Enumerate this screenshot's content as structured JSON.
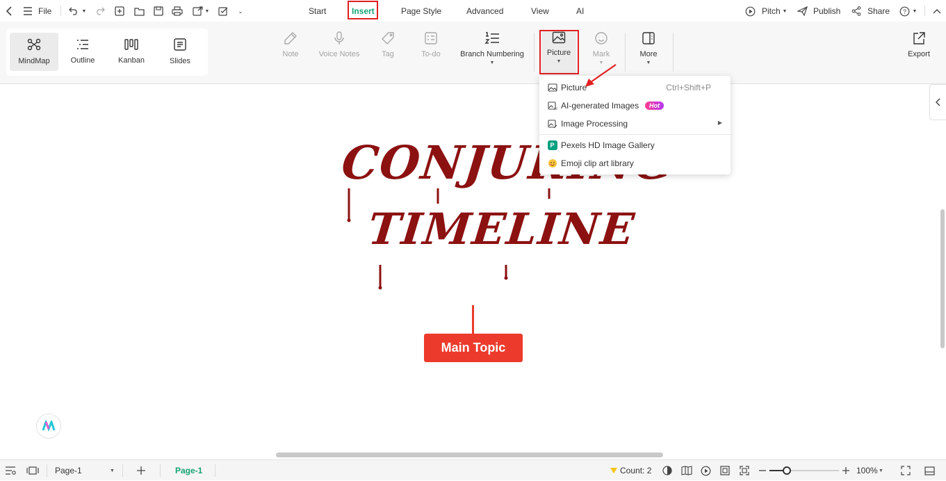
{
  "titlebar": {
    "file_label": "File",
    "menu_tabs": [
      "Start",
      "Insert",
      "Page Style",
      "Advanced",
      "View",
      "AI"
    ],
    "pitch_label": "Pitch",
    "publish_label": "Publish",
    "share_label": "Share"
  },
  "views": {
    "mindmap": "MindMap",
    "outline": "Outline",
    "kanban": "Kanban",
    "slides": "Slides"
  },
  "tools": {
    "note": "Note",
    "voice_notes": "Voice Notes",
    "tag": "Tag",
    "todo": "To-do",
    "branch_numbering": "Branch Numbering",
    "picture": "Picture",
    "mark": "Mark",
    "more": "More",
    "export": "Export"
  },
  "dropdown": {
    "picture": "Picture",
    "picture_shortcut": "Ctrl+Shift+P",
    "ai_images": "AI-generated Images",
    "hot_badge": "Hot",
    "image_processing": "Image Processing",
    "pexels": "Pexels HD Image Gallery",
    "emoji": "Emoji clip art library"
  },
  "canvas": {
    "art_line1": "CONJURING",
    "art_line2": "TIMELINE",
    "main_topic": "Main Topic"
  },
  "statusbar": {
    "page_select": "Page-1",
    "page_tab": "Page-1",
    "count": "Count: 2",
    "zoom": "100%"
  },
  "colors": {
    "accent": "#17a374",
    "highlight": "#e02020",
    "topic": "#ec3b2c",
    "art": "#8c1111"
  }
}
